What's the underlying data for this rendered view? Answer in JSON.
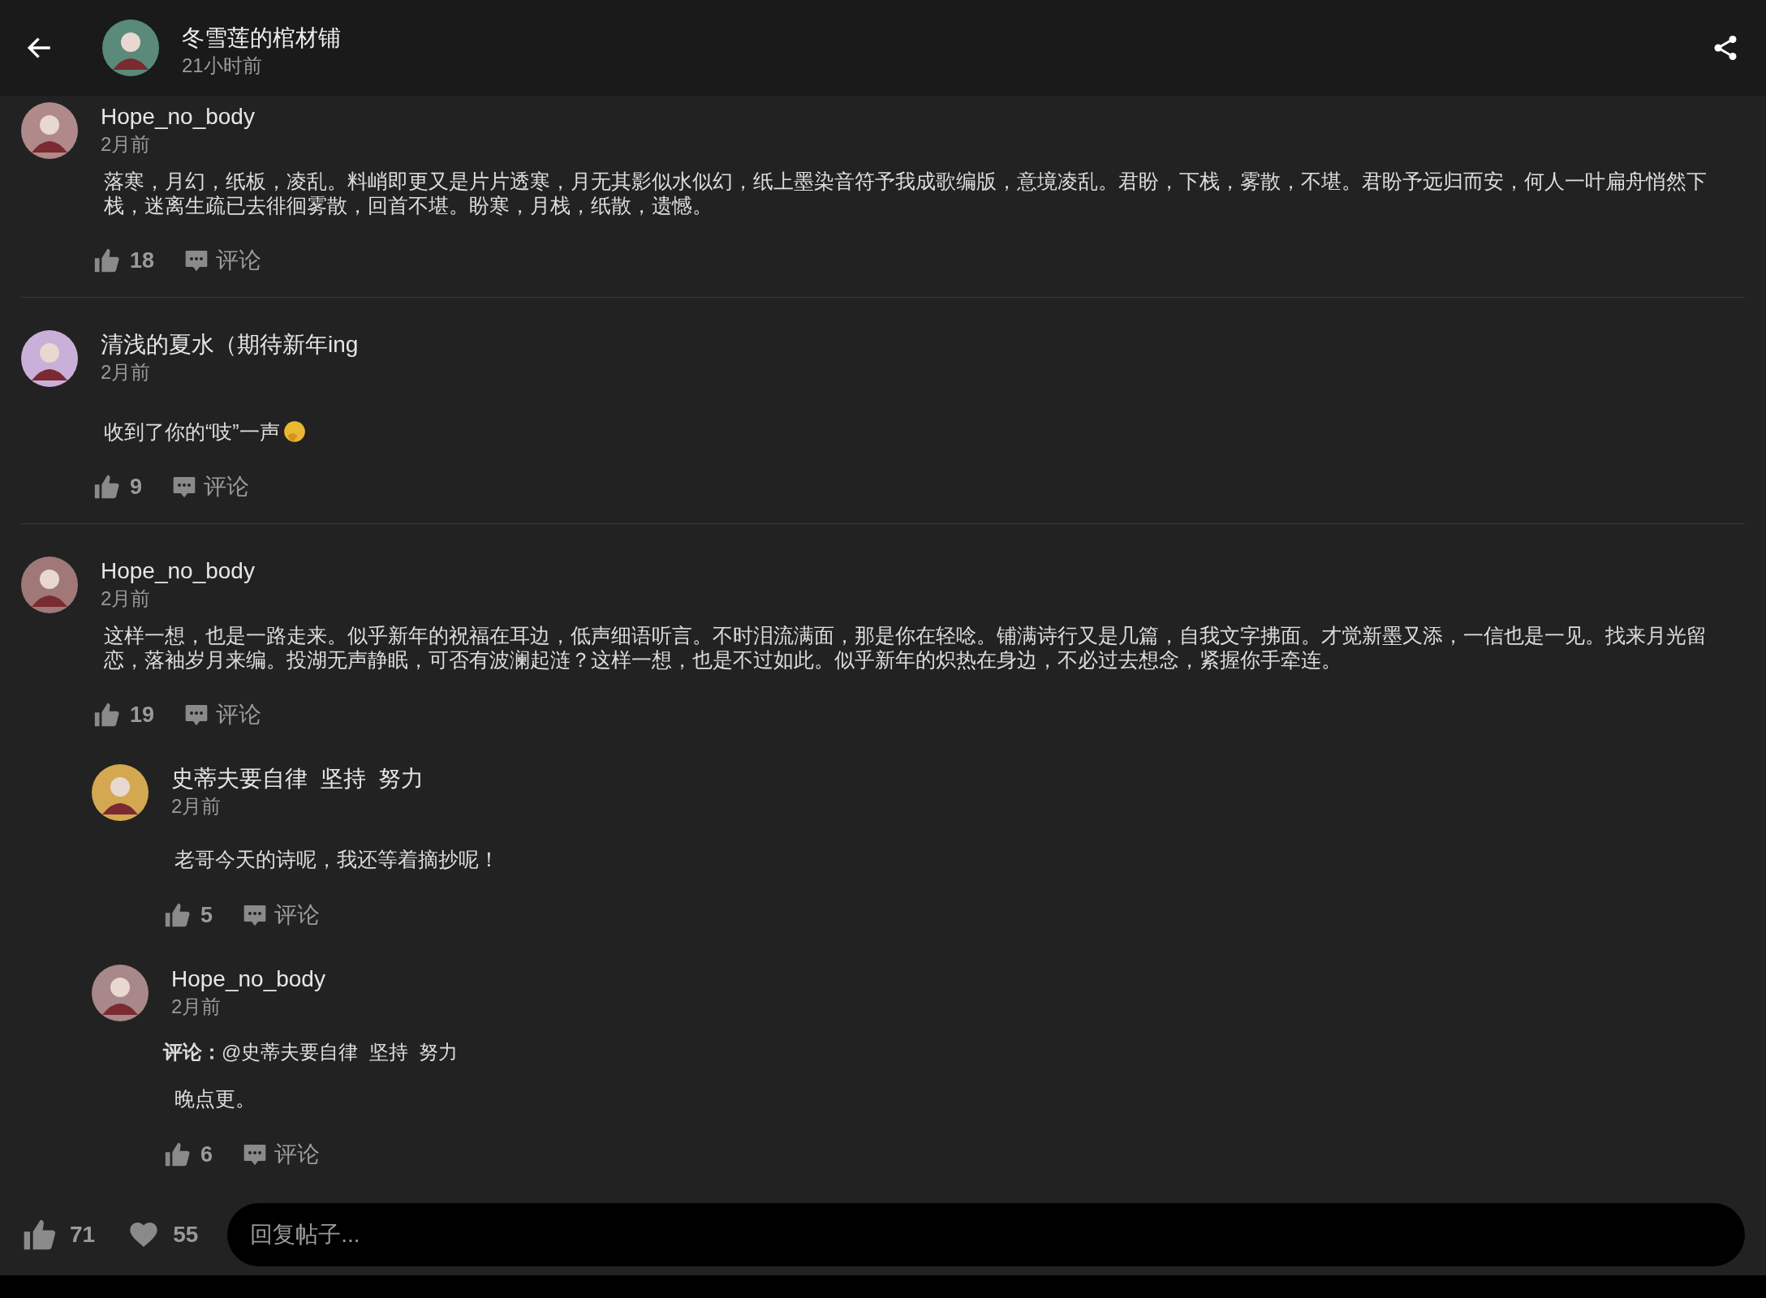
{
  "header": {
    "title": "冬雪莲的棺材铺",
    "subtitle": "21小时前"
  },
  "comments": [
    {
      "author": "Hope_no_body",
      "time": "2月前",
      "body": "落寒，月幻，纸板，凌乱。料峭即更又是片片透寒，月无其影似水似幻，纸上墨染音符予我成歌编版，意境凌乱。君盼，下栈，雾散，不堪。君盼予远归而安，何人一叶扁舟悄然下栈，迷离生疏已去徘徊雾散，回首不堪。盼寒，月栈，纸散，遗憾。",
      "emoji": false,
      "likes": "18",
      "comment_label": "评论"
    },
    {
      "author": "清浅的夏水（期待新年ing",
      "time": "2月前",
      "body": "收到了你的“吱”一声",
      "emoji": true,
      "likes": "9",
      "comment_label": "评论"
    },
    {
      "author": "Hope_no_body",
      "time": "2月前",
      "body": "这样一想，也是一路走来。似乎新年的祝福在耳边，低声细语听言。不时泪流满面，那是你在轻唸。铺满诗行又是几篇，自我文字拂面。才觉新墨又添，一信也是一见。找来月光留恋，落袖岁月来编。投湖无声静眠，可否有波澜起涟？这样一想，也是不过如此。似乎新年的炽热在身边，不必过去想念，紧握你手牵连。",
      "emoji": false,
      "likes": "19",
      "comment_label": "评论",
      "replies": [
        {
          "author": "史蒂夫要自律  坚持  努力",
          "time": "2月前",
          "body": "老哥今天的诗呢，我还等着摘抄呢！",
          "likes": "5",
          "comment_label": "评论"
        },
        {
          "author": "Hope_no_body",
          "time": "2月前",
          "reply_to": "**评论：**@史蒂夫要自律  坚持  努力",
          "body": "晚点更。",
          "likes": "6",
          "comment_label": "评论"
        }
      ]
    }
  ],
  "footer": {
    "likes": "71",
    "favorites": "55",
    "placeholder": "回复帖子..."
  }
}
